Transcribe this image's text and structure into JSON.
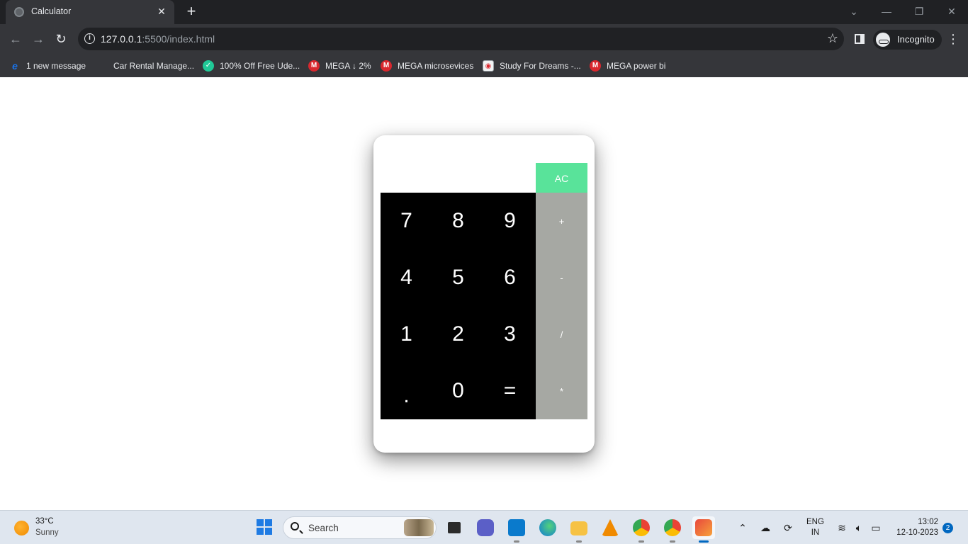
{
  "browser": {
    "tab_title": "Calculator",
    "url_host": "127.0.0.1",
    "url_rest": ":5500/index.html",
    "profile_label": "Incognito",
    "bookmarks": [
      {
        "label": "1 new message",
        "icon": "edge-e-icon"
      },
      {
        "label": "Car Rental Manage...",
        "icon": "blank-icon"
      },
      {
        "label": "100% Off Free Ude...",
        "icon": "green-circle-icon"
      },
      {
        "label": "MEGA ↓ 2%",
        "icon": "mega-icon"
      },
      {
        "label": "MEGA microsevices",
        "icon": "mega-icon"
      },
      {
        "label": "Study For Dreams -...",
        "icon": "sfd-icon"
      },
      {
        "label": "MEGA power bi",
        "icon": "mega-icon"
      }
    ]
  },
  "calculator": {
    "display_value": "",
    "clear_label": "AC",
    "digits": [
      "7",
      "8",
      "9",
      "4",
      "5",
      "6",
      "1",
      "2",
      "3",
      ".",
      "0",
      "="
    ],
    "operators": [
      "+",
      "-",
      "/",
      "*"
    ],
    "colors": {
      "clear": "#59e39a",
      "operators": "#a6a8a3",
      "keypad": "#000000"
    }
  },
  "taskbar": {
    "temperature": "33°C",
    "condition": "Sunny",
    "search_label": "Search",
    "lang_line1": "ENG",
    "lang_line2": "IN",
    "time": "13:02",
    "date": "12-10-2023",
    "notification_count": "2"
  }
}
